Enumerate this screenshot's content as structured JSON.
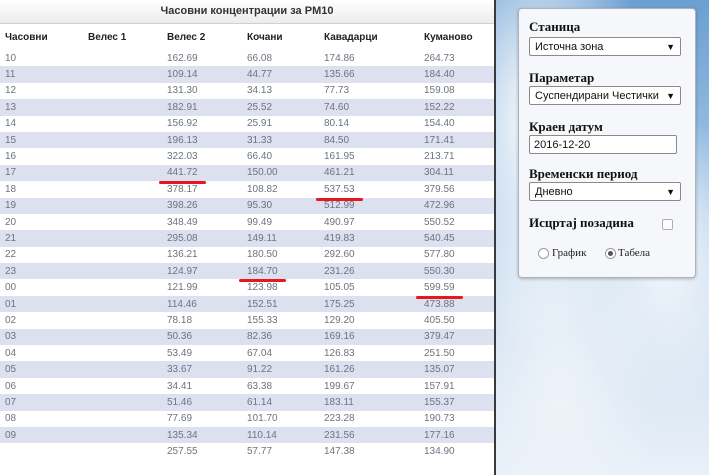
{
  "table": {
    "title": "Часовни концентрации за PM10",
    "headers": [
      "Часовни",
      "Велес 1",
      "Велес 2",
      "Кочани",
      "Кавадарци",
      "Куманово"
    ],
    "rows": [
      [
        "10",
        "",
        "162.69",
        "66.08",
        "174.86",
        "264.73"
      ],
      [
        "11",
        "",
        "109.14",
        "44.77",
        "135.66",
        "184.40"
      ],
      [
        "12",
        "",
        "131.30",
        "34.13",
        "77.73",
        "159.08"
      ],
      [
        "13",
        "",
        "182.91",
        "25.52",
        "74.60",
        "152.22"
      ],
      [
        "14",
        "",
        "156.92",
        "25.91",
        "80.14",
        "154.40"
      ],
      [
        "15",
        "",
        "196.13",
        "31.33",
        "84.50",
        "171.41"
      ],
      [
        "16",
        "",
        "322.03",
        "66.40",
        "161.95",
        "213.71"
      ],
      [
        "17",
        "",
        "441.72",
        "150.00",
        "461.21",
        "304.11"
      ],
      [
        "18",
        "",
        "378.17",
        "108.82",
        "537.53",
        "379.56"
      ],
      [
        "19",
        "",
        "398.26",
        "95.30",
        "512.99",
        "472.96"
      ],
      [
        "20",
        "",
        "348.49",
        "99.49",
        "490.97",
        "550.52"
      ],
      [
        "21",
        "",
        "295.08",
        "149.11",
        "419.83",
        "540.45"
      ],
      [
        "22",
        "",
        "136.21",
        "180.50",
        "292.60",
        "577.80"
      ],
      [
        "23",
        "",
        "124.97",
        "184.70",
        "231.26",
        "550.30"
      ],
      [
        "00",
        "",
        "121.99",
        "123.98",
        "105.05",
        "599.59"
      ],
      [
        "01",
        "",
        "114.46",
        "152.51",
        "175.25",
        "473.88"
      ],
      [
        "02",
        "",
        "78.18",
        "155.33",
        "129.20",
        "405.50"
      ],
      [
        "03",
        "",
        "50.36",
        "82.36",
        "169.16",
        "379.47"
      ],
      [
        "04",
        "",
        "53.49",
        "67.04",
        "126.83",
        "251.50"
      ],
      [
        "05",
        "",
        "33.67",
        "91.22",
        "161.26",
        "135.07"
      ],
      [
        "06",
        "",
        "34.41",
        "63.38",
        "199.67",
        "157.91"
      ],
      [
        "07",
        "",
        "51.46",
        "61.14",
        "183.11",
        "155.37"
      ],
      [
        "08",
        "",
        "77.69",
        "101.70",
        "223.28",
        "190.73"
      ],
      [
        "09",
        "",
        "135.34",
        "110.14",
        "231.56",
        "177.16"
      ],
      [
        "",
        "",
        "257.55",
        "57.77",
        "147.38",
        "134.90"
      ]
    ],
    "highlights": [
      {
        "row": 7,
        "col": 2
      },
      {
        "row": 8,
        "col": 4
      },
      {
        "row": 13,
        "col": 3
      },
      {
        "row": 14,
        "col": 5
      }
    ],
    "highlight_color": "#e8161e",
    "stripe_color": "#dde0ee"
  },
  "form": {
    "station_label": "Станица",
    "station_value": "Источна зона",
    "parameter_label": "Параметар",
    "parameter_value": "Суспендирани Честички",
    "end_date_label": "Краен датум",
    "end_date_value": "2016-12-20",
    "period_label": "Временски период",
    "period_value": "Дневно",
    "background_label": "Исцртај позадина",
    "graph_label": "График",
    "table_label": "Табела",
    "selected_view": "Табела"
  }
}
